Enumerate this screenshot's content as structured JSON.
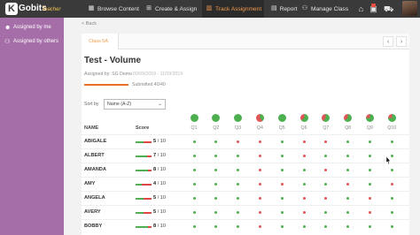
{
  "brand": {
    "name": "Gobits",
    "badge": "K",
    "sub": "Teacher"
  },
  "nav": [
    {
      "label": "Browse Content",
      "icon": "grid-icon",
      "glyph": "▦",
      "active": false
    },
    {
      "label": "Create & Assign",
      "icon": "plus-square-icon",
      "glyph": "⊞",
      "active": false
    },
    {
      "label": "Track Assignment",
      "icon": "chart-icon",
      "glyph": "▥",
      "active": true
    },
    {
      "label": "Report",
      "icon": "report-icon",
      "glyph": "▤",
      "active": false
    },
    {
      "label": "Manage Class",
      "icon": "users-icon",
      "glyph": "⚇",
      "active": false
    }
  ],
  "sidebar": {
    "items": [
      {
        "label": "Assigned by me",
        "icon": "user-icon",
        "glyph": "☻"
      },
      {
        "label": "Assigned by others",
        "icon": "users-icon",
        "glyph": "⚇"
      }
    ]
  },
  "back_label": "< Back",
  "class_tab": "Class 5A",
  "assignment": {
    "title": "Test - Volume",
    "assigned_by": "Assigned by: SG Demo",
    "dates": "09/09/2019 - 11/09/2019",
    "submitted": "Submitted 40/40",
    "submitted_fraction": 1.0
  },
  "sort": {
    "label": "Sort by",
    "value": "Name (A-Z)"
  },
  "columns": {
    "name": "NAME",
    "score": "Score"
  },
  "colors": {
    "correct": "#4caf50",
    "wrong": "#e05555",
    "accent": "#f29a4a"
  },
  "questions": [
    {
      "label": "Q1",
      "correct_fraction": 1.0
    },
    {
      "label": "Q2",
      "correct_fraction": 1.0
    },
    {
      "label": "Q3",
      "correct_fraction": 1.0
    },
    {
      "label": "Q4",
      "correct_fraction": 0.4
    },
    {
      "label": "Q5",
      "correct_fraction": 1.0
    },
    {
      "label": "Q6",
      "correct_fraction": 0.65
    },
    {
      "label": "Q7",
      "correct_fraction": 0.6
    },
    {
      "label": "Q8",
      "correct_fraction": 0.65
    },
    {
      "label": "Q9",
      "correct_fraction": 0.75
    },
    {
      "label": "Q10",
      "correct_fraction": 0.75
    }
  ],
  "students": [
    {
      "name": "ABIGALE",
      "score": "5",
      "total": "/ 10",
      "answers": [
        1,
        1,
        0,
        0,
        1,
        0,
        0,
        1,
        1,
        1
      ]
    },
    {
      "name": "ALBERT",
      "score": "7",
      "total": "/ 10",
      "answers": [
        1,
        1,
        1,
        0,
        1,
        0,
        1,
        1,
        1,
        1
      ]
    },
    {
      "name": "AMANDA",
      "score": "8",
      "total": "/ 10",
      "answers": [
        1,
        1,
        1,
        0,
        1,
        1,
        0,
        1,
        1,
        1
      ]
    },
    {
      "name": "AMY",
      "score": "4",
      "total": "/ 10",
      "answers": [
        1,
        1,
        1,
        0,
        0,
        1,
        1,
        0,
        1,
        0
      ]
    },
    {
      "name": "ANGELA",
      "score": "5",
      "total": "/ 10",
      "answers": [
        1,
        1,
        1,
        0,
        1,
        0,
        0,
        1,
        0,
        1
      ]
    },
    {
      "name": "AVERY",
      "score": "5",
      "total": "/ 10",
      "answers": [
        1,
        1,
        1,
        0,
        1,
        0,
        1,
        1,
        0,
        1
      ]
    },
    {
      "name": "BOBBY",
      "score": "8",
      "total": "/ 10",
      "answers": [
        1,
        1,
        1,
        0,
        1,
        1,
        1,
        1,
        1,
        1
      ]
    }
  ]
}
